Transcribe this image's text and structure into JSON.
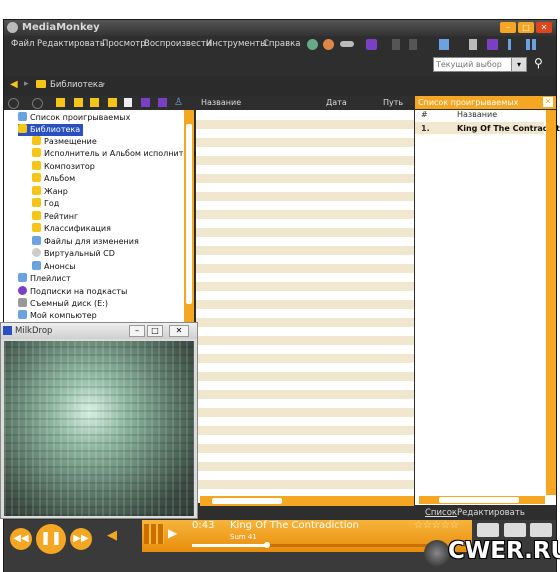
{
  "app": {
    "title": "MediaMonkey"
  },
  "menubar": {
    "items": [
      "Файл",
      "Редактировать",
      "Просмотр",
      "Воспроизвести",
      "Инструменты",
      "Справка"
    ]
  },
  "toolbar": {
    "search_placeholder": "Текущий выбор"
  },
  "navbar": {
    "breadcrumb": "Библиотека"
  },
  "tree": {
    "items": [
      {
        "label": "Список проигрываемых",
        "icon": "playlist-icon"
      },
      {
        "label": "Библиотека",
        "icon": "folder-icon",
        "selected": true
      },
      {
        "label": "Размещение",
        "icon": "location-icon"
      },
      {
        "label": "Исполнитель и Альбом исполнителя",
        "icon": "artist-album-icon"
      },
      {
        "label": "Композитор",
        "icon": "composer-icon"
      },
      {
        "label": "Альбом",
        "icon": "album-icon"
      },
      {
        "label": "Жанр",
        "icon": "genre-icon"
      },
      {
        "label": "Год",
        "icon": "year-icon"
      },
      {
        "label": "Рейтинг",
        "icon": "rating-icon"
      },
      {
        "label": "Классификация",
        "icon": "classification-icon"
      },
      {
        "label": "Файлы для изменения",
        "icon": "files-icon"
      },
      {
        "label": "Виртуальный CD",
        "icon": "cd-icon"
      },
      {
        "label": "Анонсы",
        "icon": "announce-icon"
      },
      {
        "label": "Плейлист",
        "icon": "playlist-icon"
      },
      {
        "label": "Подписки на подкасты",
        "icon": "podcast-icon"
      },
      {
        "label": "Съемный диск (E:)",
        "icon": "drive-icon"
      },
      {
        "label": "Мой компьютер",
        "icon": "computer-icon"
      }
    ]
  },
  "tracklist": {
    "columns": [
      "Название",
      "Дата",
      "Путь"
    ]
  },
  "nowplaying_panel": {
    "title": "Список проигрываемых",
    "col_num": "#",
    "col_name": "Название",
    "rows": [
      {
        "num": "1.",
        "title": "King Of The Contradicti..."
      }
    ],
    "tab_list": "Список",
    "tab_edit": "Редактировать"
  },
  "milkdrop": {
    "title": "MilkDrop"
  },
  "player": {
    "time": "0:43",
    "track": "King Of The Contradiction",
    "artist": "Sum 41",
    "progress": 0.3
  },
  "watermark": {
    "text": "CWER.RU"
  },
  "colors": {
    "accent": "#f5a623",
    "window_dark": "#2e2e2e",
    "selection": "#2a4fbf",
    "stripe": "#f1e7cf"
  }
}
